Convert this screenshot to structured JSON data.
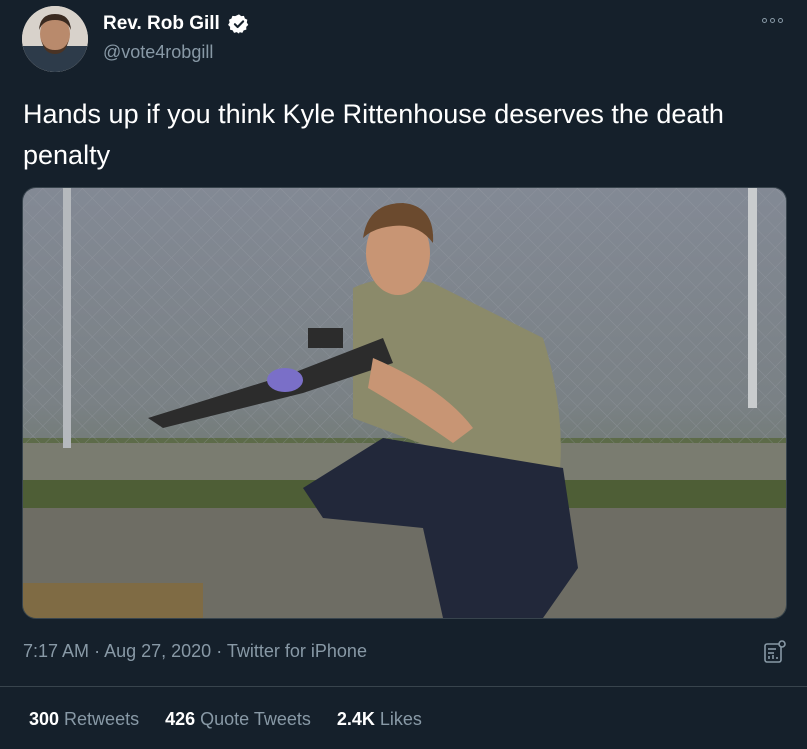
{
  "author": {
    "display_name": "Rev. Rob Gill",
    "handle": "@vote4robgill",
    "verified": true
  },
  "tweet": {
    "text": "Hands up if you think Kyle Rittenhouse deserves the death penalty",
    "time": "7:17 AM",
    "date": "Aug 27, 2020",
    "source": "Twitter for iPhone",
    "separator": "·"
  },
  "stats": {
    "retweets_count": "300",
    "retweets_label": "Retweets",
    "quotes_count": "426",
    "quotes_label": "Quote Tweets",
    "likes_count": "2.4K",
    "likes_label": "Likes"
  },
  "colors": {
    "background": "#15202b",
    "secondary_text": "#8899a6",
    "divider": "#38444d",
    "verified_badge": "#ffffff"
  },
  "icons": [
    "verified-badge-icon",
    "more-options-icon",
    "analytics-icon"
  ]
}
